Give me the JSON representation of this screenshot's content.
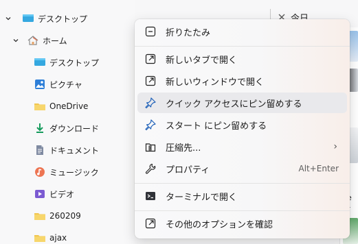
{
  "nav": {
    "items": [
      {
        "label": "デスクトップ",
        "icon": "desktop-folder-icon",
        "chevron": "chevron-down-icon"
      },
      {
        "label": "ホーム",
        "icon": "home-icon",
        "chevron": "chevron-down-icon"
      },
      {
        "label": "デスクトップ",
        "icon": "desktop-folder-icon"
      },
      {
        "label": "ピクチャ",
        "icon": "pictures-icon"
      },
      {
        "label": "OneDrive",
        "icon": "folder-icon"
      },
      {
        "label": "ダウンロード",
        "icon": "download-icon"
      },
      {
        "label": "ドキュメント",
        "icon": "documents-icon"
      },
      {
        "label": "ミュージック",
        "icon": "music-icon"
      },
      {
        "label": "ビデオ",
        "icon": "video-icon"
      },
      {
        "label": "260209",
        "icon": "folder-icon"
      },
      {
        "label": "ajax",
        "icon": "folder-icon"
      }
    ]
  },
  "right_pane": {
    "header_text": "今日",
    "close_icon": "close-icon",
    "edge_text_1": "e",
    "edge_text_2": "r"
  },
  "context_menu": {
    "items": [
      {
        "label": "折りたたみ",
        "icon": "collapse-icon"
      },
      {
        "label": "新しいタブで開く",
        "icon": "open-new-tab-icon"
      },
      {
        "label": "新しいウィンドウで開く",
        "icon": "open-new-window-icon"
      },
      {
        "label": "クイック アクセスにピン留めする",
        "icon": "pin-icon",
        "highlighted": true
      },
      {
        "label": "スタート にピン留めする",
        "icon": "pin-start-icon"
      },
      {
        "label": "圧縮先...",
        "icon": "compress-icon",
        "submenu": true
      },
      {
        "label": "プロパティ",
        "icon": "wrench-icon",
        "shortcut": "Alt+Enter"
      },
      {
        "label": "ターミナルで開く",
        "icon": "terminal-icon"
      },
      {
        "label": "その他のオプションを確認",
        "icon": "more-options-icon"
      }
    ]
  },
  "colors": {
    "folder": "#f2c75c",
    "blue": "#1a73d9",
    "accent": "#3269c6",
    "terminal": "#303238"
  }
}
